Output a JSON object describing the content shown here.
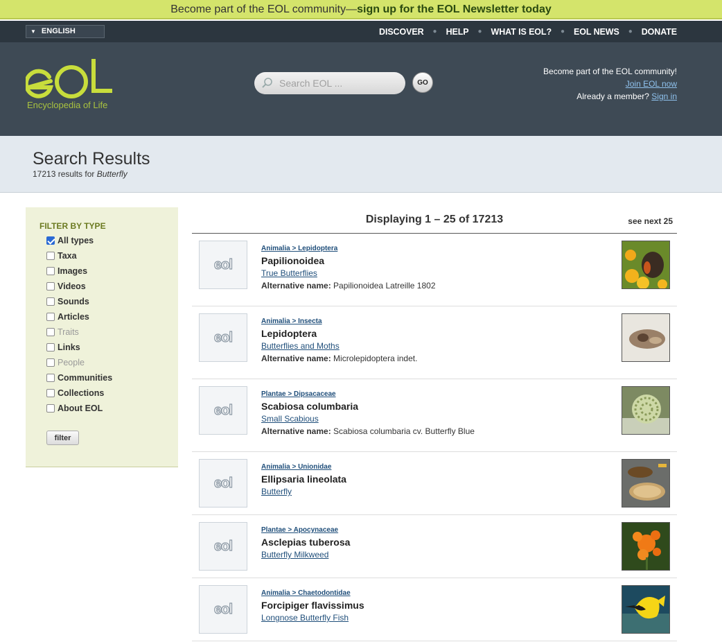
{
  "promo": {
    "text_prefix": "Become part of the EOL community—",
    "text_link": "sign up for the EOL Newsletter today"
  },
  "utility": {
    "language": "ENGLISH",
    "nav": [
      "DISCOVER",
      "HELP",
      "WHAT IS EOL?",
      "EOL NEWS",
      "DONATE"
    ]
  },
  "header": {
    "logo_text": "eol",
    "logo_subtitle": "Encyclopedia of Life",
    "search_placeholder": "Search EOL ...",
    "go_label": "GO",
    "join_line1": "Become part of the EOL community!",
    "join_link": "Join EOL now",
    "member_prefix": "Already a member?",
    "signin_link": "Sign in"
  },
  "results_header": {
    "title": "Search Results",
    "count_prefix": "17213 results for",
    "query": "Butterfly"
  },
  "filter": {
    "heading": "FILTER BY TYPE",
    "items": [
      {
        "label": "All types",
        "checked": true,
        "disabled": false
      },
      {
        "label": "Taxa",
        "checked": false,
        "disabled": false
      },
      {
        "label": "Images",
        "checked": false,
        "disabled": false
      },
      {
        "label": "Videos",
        "checked": false,
        "disabled": false
      },
      {
        "label": "Sounds",
        "checked": false,
        "disabled": false
      },
      {
        "label": "Articles",
        "checked": false,
        "disabled": false
      },
      {
        "label": "Traits",
        "checked": false,
        "disabled": true
      },
      {
        "label": "Links",
        "checked": false,
        "disabled": false
      },
      {
        "label": "People",
        "checked": false,
        "disabled": true
      },
      {
        "label": "Communities",
        "checked": false,
        "disabled": false
      },
      {
        "label": "Collections",
        "checked": false,
        "disabled": false
      },
      {
        "label": "About EOL",
        "checked": false,
        "disabled": false
      }
    ],
    "button": "filter"
  },
  "results": {
    "displaying": "Displaying 1 – 25 of 17213",
    "see_next": "see next 25",
    "thumb_logo": "eol",
    "alt_label": "Alternative name:",
    "items": [
      {
        "crumb": "Animalia > Lepidoptera",
        "name": "Papilionoidea",
        "common": "True Butterflies",
        "alt": "Papilionoidea Latreille 1802",
        "pic": "butterfly-flowers"
      },
      {
        "crumb": "Animalia > Insecta",
        "name": "Lepidoptera",
        "common": "Butterflies and Moths",
        "alt": "Microlepidoptera indet.",
        "pic": "moth"
      },
      {
        "crumb": "Plantae > Dipsacaceae",
        "name": "Scabiosa columbaria",
        "common": "Small Scabious",
        "alt": "Scabiosa columbaria cv. Butterfly Blue",
        "pic": "seedhead"
      },
      {
        "crumb": "Animalia > Unionidae",
        "name": "Ellipsaria lineolata",
        "common": "Butterfly",
        "alt": "",
        "pic": "mussel"
      },
      {
        "crumb": "Plantae > Apocynaceae",
        "name": "Asclepias tuberosa",
        "common": "Butterfly Milkweed",
        "alt": "",
        "pic": "orange-flowers"
      },
      {
        "crumb": "Animalia > Chaetodontidae",
        "name": "Forcipiger flavissimus",
        "common": "Longnose Butterfly Fish",
        "alt": "",
        "pic": "fish"
      }
    ]
  }
}
